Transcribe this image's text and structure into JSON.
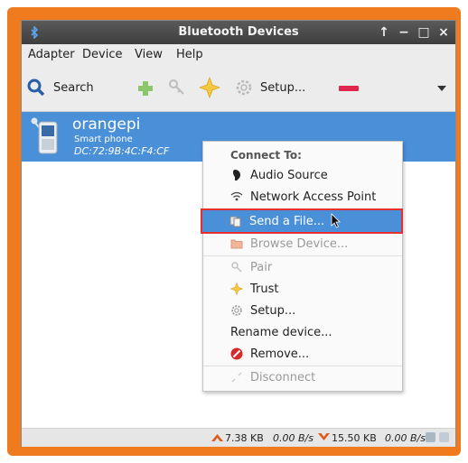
{
  "window": {
    "title": "Bluetooth Devices",
    "controls": [
      "↑",
      "−",
      "□",
      "×"
    ]
  },
  "menubar": [
    "Adapter",
    "Device",
    "View",
    "Help"
  ],
  "toolbar": {
    "search_label": "Search",
    "setup_label": "Setup...",
    "icons": [
      "search-icon",
      "add-icon",
      "key-icon",
      "star-icon",
      "gear-icon",
      "remove-icon",
      "dropdown-icon"
    ]
  },
  "device": {
    "name": "orangepi",
    "type": "Smart phone",
    "mac": "DC:72:9B:4C:F4:CF"
  },
  "context_menu": {
    "header": "Connect To:",
    "items": [
      {
        "label": "Audio Source",
        "icon": "audio-icon",
        "enabled": true
      },
      {
        "label": "Network Access Point",
        "icon": "network-icon",
        "enabled": true
      },
      {
        "label": "Send a File...",
        "icon": "send-file-icon",
        "enabled": true,
        "selected": true
      },
      {
        "label": "Browse Device...",
        "icon": "folder-icon",
        "enabled": false
      },
      {
        "label": "Pair",
        "icon": "pair-icon",
        "enabled": false
      },
      {
        "label": "Trust",
        "icon": "star-icon",
        "enabled": true
      },
      {
        "label": "Setup...",
        "icon": "gear-icon",
        "enabled": true
      },
      {
        "label": "Rename device...",
        "icon": "",
        "enabled": true
      },
      {
        "label": "Remove...",
        "icon": "remove-icon",
        "enabled": true
      },
      {
        "label": "Disconnect",
        "icon": "disconnect-icon",
        "enabled": false
      }
    ]
  },
  "statusbar": {
    "up_total": "7.38 KB",
    "up_rate": "0.00 B/s",
    "down_total": "15.50 KB",
    "down_rate": "0.00 B/s"
  },
  "colors": {
    "frame": "#f07a1e",
    "selection": "#4a90d9",
    "highlight_border": "#e63030"
  }
}
